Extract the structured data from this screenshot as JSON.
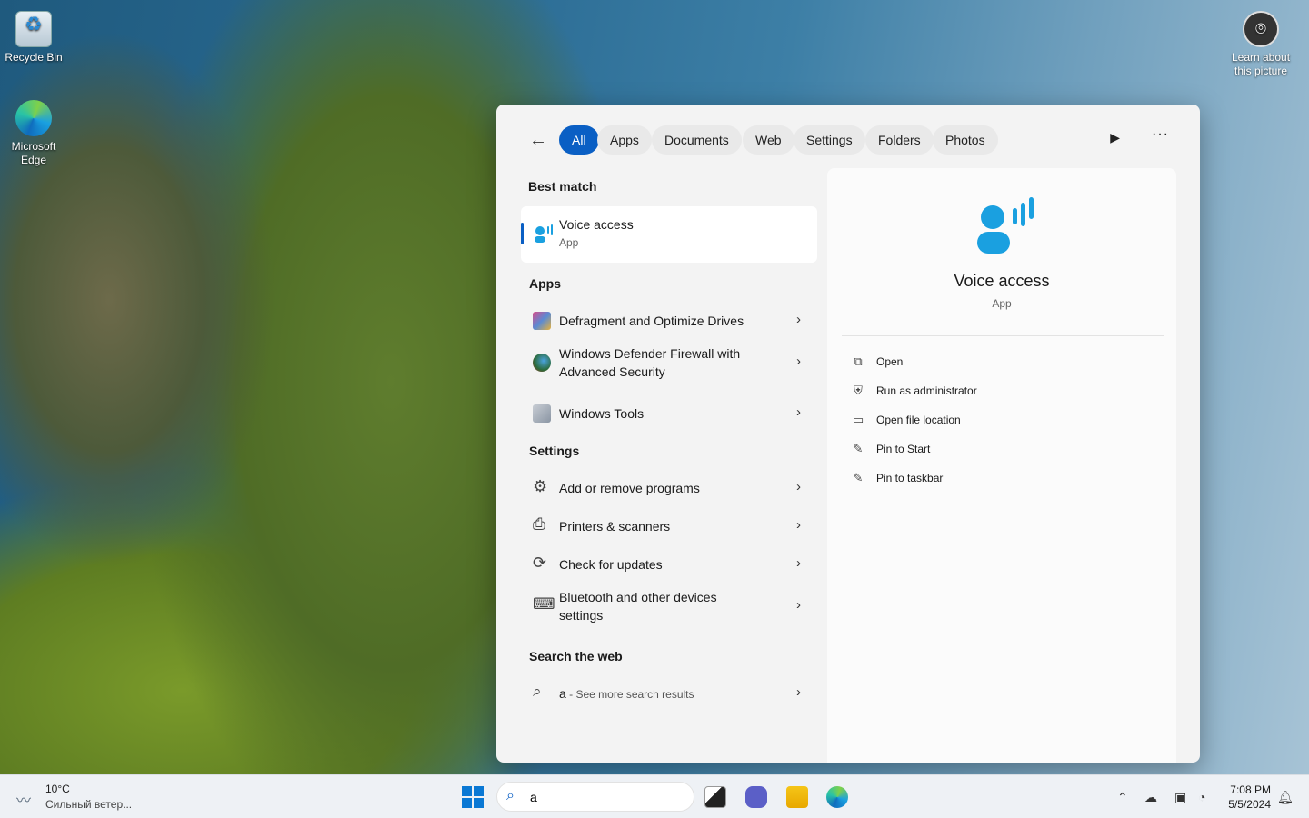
{
  "desktop": {
    "icons": [
      {
        "label": "Recycle Bin"
      },
      {
        "label": "Microsoft Edge"
      },
      {
        "label": "Learn about this picture"
      }
    ]
  },
  "search_panel": {
    "filters": [
      "All",
      "Apps",
      "Documents",
      "Web",
      "Settings",
      "Folders",
      "Photos"
    ],
    "active_filter": "All",
    "best_match": {
      "heading": "Best match",
      "title": "Voice access",
      "subtitle": "App"
    },
    "apps": {
      "heading": "Apps",
      "items": [
        "Defragment and Optimize Drives",
        "Windows Defender Firewall with Advanced Security",
        "Windows Tools"
      ]
    },
    "settings": {
      "heading": "Settings",
      "items": [
        "Add or remove programs",
        "Printers & scanners",
        "Check for updates",
        "Bluetooth and other devices settings"
      ]
    },
    "web": {
      "heading": "Search the web",
      "query": "a",
      "suffix": " - See more search results"
    },
    "details": {
      "title": "Voice access",
      "subtitle": "App",
      "actions": [
        {
          "label": "Open",
          "icon": "open-external-icon"
        },
        {
          "label": "Run as administrator",
          "icon": "shield-admin-icon"
        },
        {
          "label": "Open file location",
          "icon": "folder-icon"
        },
        {
          "label": "Pin to Start",
          "icon": "pin-icon"
        },
        {
          "label": "Pin to taskbar",
          "icon": "pin-icon"
        }
      ]
    }
  },
  "taskbar": {
    "weather_temp": "10°C",
    "weather_desc": "Сильный ветер...",
    "search_value": "a",
    "time": "7:08 PM",
    "date": "5/5/2024"
  },
  "colors": {
    "accent": "#0a5fc4",
    "voice_icon": "#1aa0e0"
  }
}
